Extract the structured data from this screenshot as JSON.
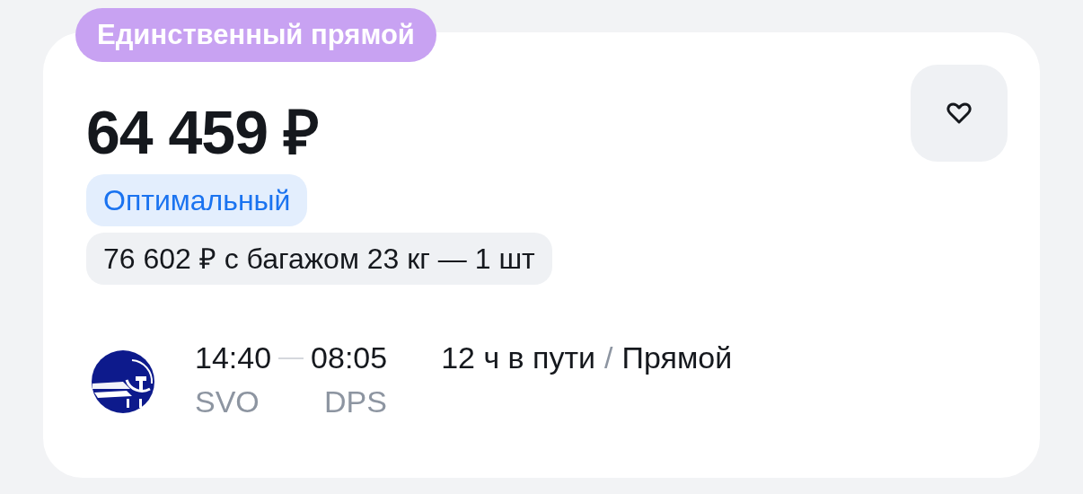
{
  "badge": "Единственный прямой",
  "price": "64 459 ₽",
  "favorite": false,
  "tariff": "Оптимальный",
  "baggage_offer": "76 602 ₽ с багажом 23 кг — 1 шт",
  "flight": {
    "departure_time": "14:40",
    "arrival_time": "08:05",
    "departure_airport": "SVO",
    "arrival_airport": "DPS",
    "duration": "12 ч в пути",
    "separator": "/",
    "stops": "Прямой"
  }
}
